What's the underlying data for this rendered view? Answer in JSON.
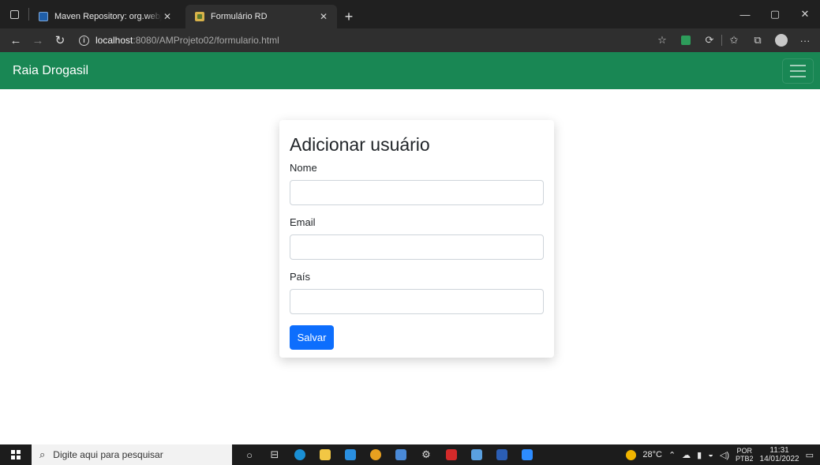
{
  "browser": {
    "tabs": [
      {
        "title": "Maven Repository: org.webjars » ",
        "active": false
      },
      {
        "title": "Formulário RD",
        "active": true
      }
    ],
    "url_host": "localhost",
    "url_rest": ":8080/AMProjeto02/formulario.html"
  },
  "page": {
    "brand": "Raia Drogasil",
    "form": {
      "title": "Adicionar usuário",
      "fields": [
        {
          "label": "Nome",
          "value": ""
        },
        {
          "label": "Email",
          "value": ""
        },
        {
          "label": "País",
          "value": ""
        }
      ],
      "submit_label": "Salvar"
    }
  },
  "taskbar": {
    "search_placeholder": "Digite aqui para pesquisar",
    "weather": "28°C",
    "lang_top": "POR",
    "lang_bottom": "PTB2",
    "time": "11:31",
    "date": "14/01/2022"
  },
  "colors": {
    "navbar": "#198754",
    "button": "#0d6efd"
  }
}
